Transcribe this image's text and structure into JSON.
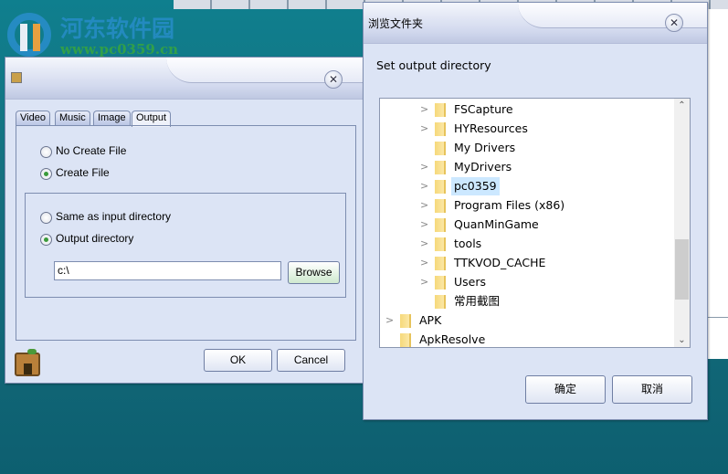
{
  "watermark": {
    "name": "河东软件园",
    "url": "www.pc0359.cn"
  },
  "left_dialog": {
    "title": "",
    "tabs": [
      {
        "label": "Video"
      },
      {
        "label": "Music"
      },
      {
        "label": "Image"
      },
      {
        "label": "Output",
        "active": true
      }
    ],
    "create_options": [
      {
        "label": "No Create File",
        "checked": false
      },
      {
        "label": "Create File",
        "checked": true
      }
    ],
    "dir_options": [
      {
        "label": "Same as input directory",
        "checked": false
      },
      {
        "label": "Output directory",
        "checked": true
      }
    ],
    "path_value": "c:\\",
    "browse_label": "Browse",
    "ok_label": "OK",
    "cancel_label": "Cancel"
  },
  "right_dialog": {
    "title": "浏览文件夹",
    "prompt": "Set output directory",
    "tree": [
      {
        "label": "FSCapture",
        "expandable": true,
        "level": 1
      },
      {
        "label": "HYResources",
        "expandable": true,
        "level": 1
      },
      {
        "label": "My Drivers",
        "expandable": false,
        "level": 1
      },
      {
        "label": "MyDrivers",
        "expandable": true,
        "level": 1
      },
      {
        "label": "pc0359",
        "expandable": true,
        "level": 1,
        "selected": true
      },
      {
        "label": "Program Files (x86)",
        "expandable": true,
        "level": 1
      },
      {
        "label": "QuanMinGame",
        "expandable": true,
        "level": 1
      },
      {
        "label": "tools",
        "expandable": true,
        "level": 1
      },
      {
        "label": "TTKVOD_CACHE",
        "expandable": true,
        "level": 1
      },
      {
        "label": "Users",
        "expandable": true,
        "level": 1
      },
      {
        "label": "常用截图",
        "expandable": false,
        "level": 1
      },
      {
        "label": "APK",
        "expandable": true,
        "level": 0
      },
      {
        "label": "ApkResolve",
        "expandable": false,
        "level": 0
      }
    ],
    "ok_label": "确定",
    "cancel_label": "取消"
  }
}
